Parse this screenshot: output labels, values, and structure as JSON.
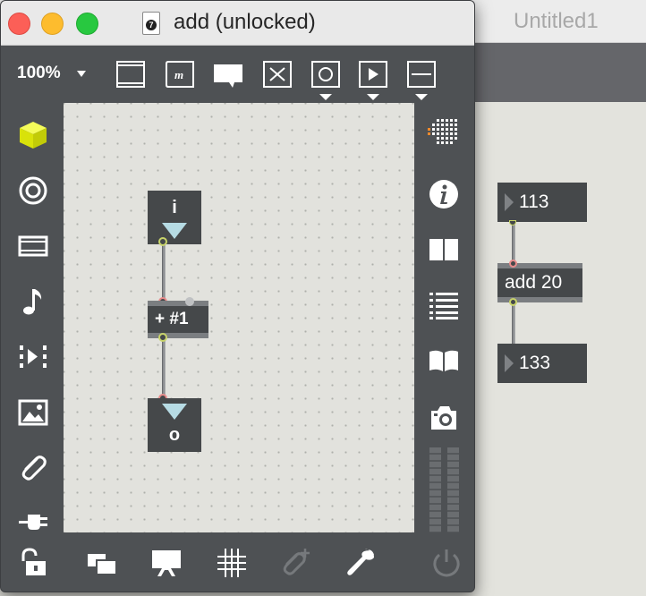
{
  "background_window": {
    "title": "Untitled1",
    "objects": {
      "number_top": "113",
      "add_object": "add 20",
      "number_bottom": "133"
    }
  },
  "window": {
    "title": "add (unlocked)",
    "zoom": "100%",
    "patch": {
      "inlet_label": "i",
      "plus_object": "+ #1",
      "outlet_label": "o"
    }
  },
  "icons": {
    "toolbar": [
      "presentation-frame-icon",
      "message-box-icon",
      "comment-icon",
      "toggle-box-icon",
      "button-object-icon",
      "play-object-icon",
      "slider-object-icon"
    ],
    "left_sidebar": [
      "object-cube-icon",
      "target-icon",
      "rack-icon",
      "music-note-icon",
      "playback-icon",
      "image-icon",
      "paperclip-icon",
      "plug-icon"
    ],
    "right_sidebar": [
      "grid-palette-icon",
      "info-icon",
      "book-open-icon",
      "list-icon",
      "reference-book-icon",
      "camera-icon",
      "level-meter"
    ],
    "bottom": [
      "lock-icon",
      "windows-icon",
      "presentation-icon",
      "grid-icon",
      "attach-plus-icon",
      "wrench-icon",
      "power-icon"
    ]
  },
  "colors": {
    "accent_yellow": "#e8f20a",
    "inlet_red": "#e88b8b",
    "outlet_yellow": "#c8d36a",
    "object_dark": "#45484a",
    "toolbar_gray": "#4e5154"
  }
}
